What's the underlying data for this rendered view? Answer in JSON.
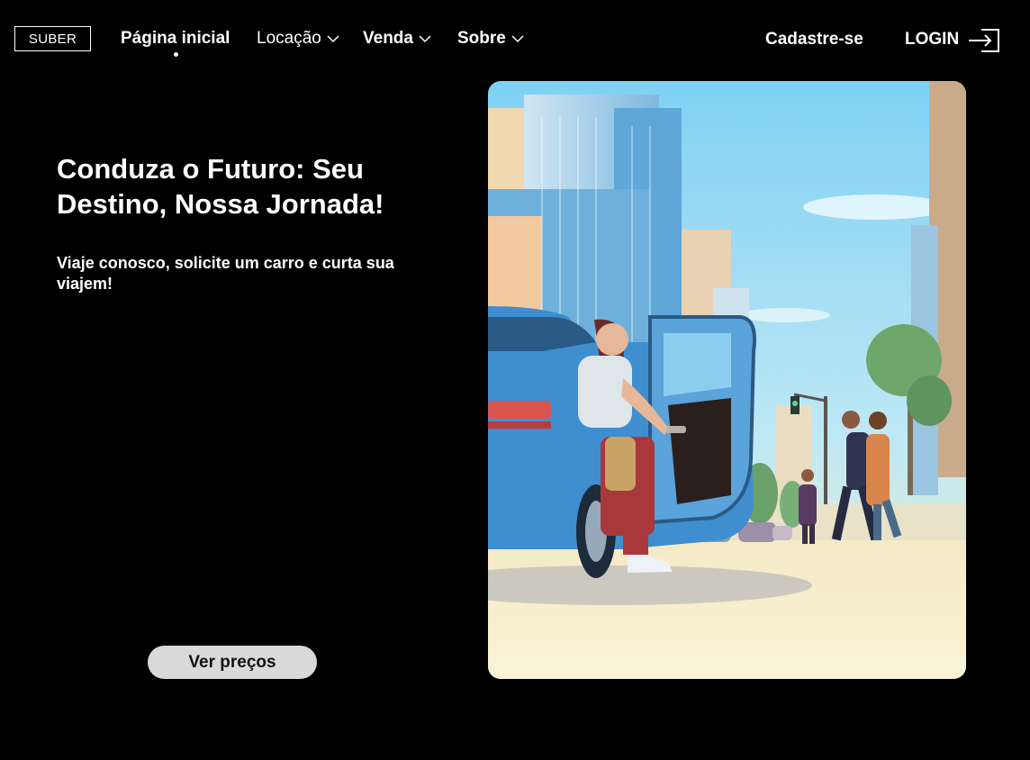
{
  "brand": {
    "logo_text": "SUBER"
  },
  "nav": {
    "items": [
      {
        "label": "Página inicial",
        "active": true
      },
      {
        "label": "Locação",
        "has_dropdown": true
      },
      {
        "label": "Venda",
        "has_dropdown": true
      },
      {
        "label": "Sobre",
        "has_dropdown": true
      }
    ],
    "signup_label": "Cadastre-se",
    "login_label": "LOGIN",
    "login_icon": "sign-in-icon"
  },
  "hero": {
    "title": "Conduza o Futuro: Seu Destino, Nossa Jornada!",
    "subtitle": "Viaje conosco, solicite um carro e curta sua viajem!",
    "cta_label": "Ver preços",
    "illustration": "city-street-rideshare-illustration"
  },
  "colors": {
    "background": "#000000",
    "text": "#ffffff",
    "button_bg": "#d9d9d9",
    "button_text": "#111111",
    "sky": "#8fd6f5",
    "car": "#3f8fd0"
  }
}
